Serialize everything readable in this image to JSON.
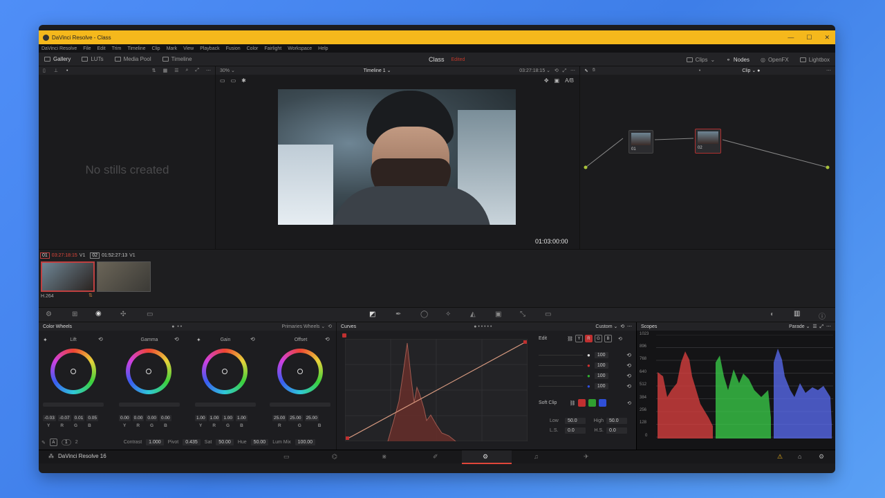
{
  "window": {
    "title": "DaVinci Resolve - Class",
    "minimize": "—",
    "maximize": "☐",
    "close": "✕"
  },
  "menu": [
    "DaVinci Resolve",
    "File",
    "Edit",
    "Trim",
    "Timeline",
    "Clip",
    "Mark",
    "View",
    "Playback",
    "Fusion",
    "Color",
    "Fairlight",
    "Workspace",
    "Help"
  ],
  "toolbar": {
    "gallery": "Gallery",
    "luts": "LUTs",
    "media_pool": "Media Pool",
    "timeline": "Timeline",
    "project_name": "Class",
    "project_status": "Edited",
    "clips": "Clips",
    "nodes": "Nodes",
    "openfx": "OpenFX",
    "lightbox": "Lightbox"
  },
  "gallery": {
    "empty_text": "No stills created"
  },
  "viewer": {
    "zoom": "30%",
    "timeline_name": "Timeline 1",
    "timecode_top": "03:27:18:15",
    "timecode": "01:03:00:00"
  },
  "nodes": {
    "mode": "Clip",
    "node1_label": "01",
    "node2_label": "02"
  },
  "clips": [
    {
      "num": "01",
      "tc": "03:27:18:15",
      "track": "V1",
      "codec": "H.264"
    },
    {
      "num": "02",
      "tc": "01:52:27:13",
      "track": "V1",
      "codec": ""
    }
  ],
  "color_wheels": {
    "title": "Color Wheels",
    "mode": "Primaries Wheels",
    "wheels": [
      {
        "name": "Lift",
        "values": [
          "-0.03",
          "-0.07",
          "0.01",
          "0.05"
        ]
      },
      {
        "name": "Gamma",
        "values": [
          "0.00",
          "0.00",
          "0.00",
          "0.00"
        ]
      },
      {
        "name": "Gain",
        "values": [
          "1.00",
          "1.00",
          "1.00",
          "1.00"
        ]
      },
      {
        "name": "Offset",
        "values": [
          "25.00",
          "25.00",
          "25.00"
        ]
      }
    ],
    "channel_labels_4": [
      "Y",
      "R",
      "G",
      "B"
    ],
    "channel_labels_3": [
      "R",
      "G",
      "B"
    ],
    "page1": "1",
    "page2": "2",
    "contrast_label": "Contrast",
    "contrast": "1.000",
    "pivot_label": "Pivot",
    "pivot": "0.435",
    "sat_label": "Sat",
    "sat": "50.00",
    "hue_label": "Hue",
    "hue": "50.00",
    "lummix_label": "Lum Mix",
    "lummix": "100.00"
  },
  "curves": {
    "title": "Curves",
    "mode": "Custom",
    "edit_label": "Edit",
    "channels": [
      "Y",
      "R",
      "G",
      "B"
    ],
    "values": [
      "100",
      "100",
      "100",
      "100"
    ],
    "soft_clip_label": "Soft Clip",
    "low_label": "Low",
    "low": "50.0",
    "high_label": "High",
    "high": "50.0",
    "ls_label": "L.S.",
    "ls": "0.0",
    "hs_label": "H.S.",
    "hs": "0.0"
  },
  "scopes": {
    "title": "Scopes",
    "mode": "Parade",
    "ticks": [
      "1023",
      "896",
      "768",
      "640",
      "512",
      "384",
      "256",
      "128",
      "0"
    ]
  },
  "bottom": {
    "app_name": "DaVinci Resolve 16"
  },
  "colors": {
    "accent": "#f5b81c",
    "red_tc": "#e0463a",
    "scope_red": "#e04040",
    "scope_green": "#3ad04a",
    "scope_blue": "#5a6cf5"
  }
}
